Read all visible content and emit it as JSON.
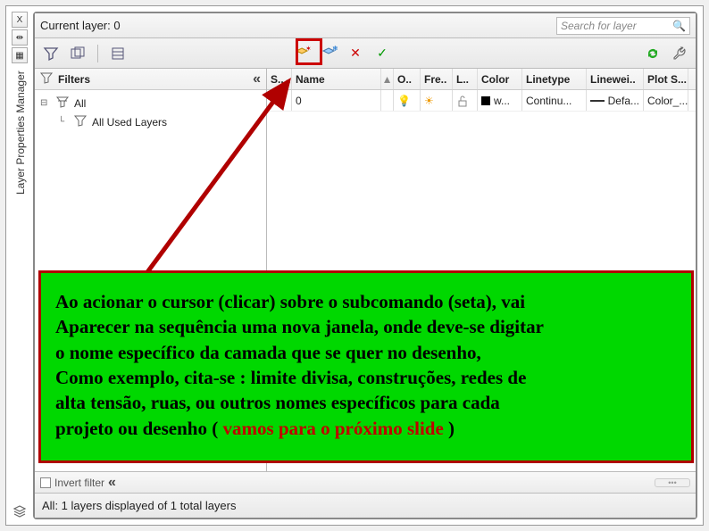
{
  "dock": {
    "close_label": "X",
    "pin_label": "⇹",
    "menu_label": "▦",
    "title": "Layer Properties Manager",
    "bottom_icon": "layers-stack-icon"
  },
  "topbar": {
    "current_layer_label": "Current layer: 0",
    "search_placeholder": "Search for layer"
  },
  "toolbar": {
    "btn_new_property_filter": "new-property-filter",
    "btn_new_group_filter": "new-group-filter",
    "btn_layer_states": "layer-states",
    "btn_new_layer": "new-layer",
    "btn_new_layer_freeze": "new-layer-freeze-vp",
    "btn_delete_layer": "delete-layer",
    "btn_set_current": "set-current",
    "btn_refresh": "refresh",
    "btn_settings": "settings"
  },
  "filters": {
    "heading": "Filters",
    "items": [
      {
        "glyph": "⊟",
        "icon": "filter-stack",
        "label": "All"
      },
      {
        "glyph": "",
        "icon": "filter-used",
        "label": "All Used Layers"
      }
    ]
  },
  "grid": {
    "columns": {
      "status": "S..",
      "name": "Name",
      "on": "O..",
      "freeze": "Fre..",
      "lock": "L..",
      "color": "Color",
      "linetype": "Linetype",
      "lineweight": "Linewei..",
      "plot": "Plot S..."
    },
    "rows": [
      {
        "status": "✓",
        "name": "0",
        "on": "bulb-on",
        "freeze": "sun",
        "lock": "unlock",
        "color_swatch": "#000000",
        "color_label": "w...",
        "linetype": "Continu...",
        "lineweight": "Defa...",
        "plot": "Color_..."
      }
    ]
  },
  "bottom_filter": {
    "label": "Invert filter"
  },
  "status": {
    "text": "All: 1 layers displayed of 1 total layers"
  },
  "annotation": {
    "line1": "Ao acionar o cursor (clicar) sobre o subcomando (seta), vai",
    "line2": "Aparecer na sequência uma nova janela, onde deve-se digitar",
    "line3": "o nome específico da camada que se quer no desenho,",
    "line4": "Como exemplo, cita-se : limite divisa, construções, redes de",
    "line5": "alta tensão, ruas, ou outros nomes específicos para cada",
    "line6a": "projeto ou desenho ( ",
    "line6b": "vamos para o próximo slide",
    "line6c": " )"
  }
}
